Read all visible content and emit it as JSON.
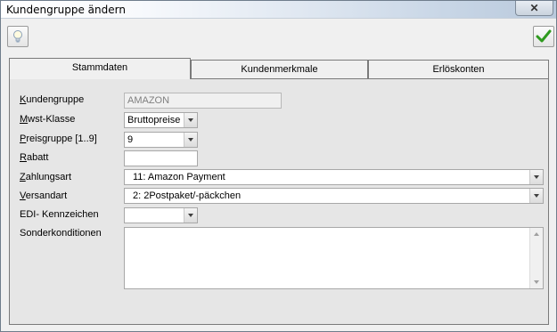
{
  "window": {
    "title": "Kundengruppe ändern",
    "close_label": "✕"
  },
  "toolbar": {
    "hint_icon": "lightbulb-icon",
    "ok_icon": "checkmark-icon"
  },
  "tabs": [
    {
      "label": "Stammdaten",
      "active": true
    },
    {
      "label": "Kundenmerkmale",
      "active": false
    },
    {
      "label": "Erlöskonten",
      "active": false
    }
  ],
  "form": {
    "kundengruppe": {
      "label_mn": "K",
      "label_rest": "undengruppe",
      "value": "AMAZON"
    },
    "mwst": {
      "label_mn": "M",
      "label_rest": "wst-Klasse",
      "value": "Bruttopreise"
    },
    "preisgruppe": {
      "label_mn": "P",
      "label_rest": "reisgruppe [1..9]",
      "value": "9"
    },
    "rabatt": {
      "label_mn": "R",
      "label_rest": "abatt",
      "value": ""
    },
    "zahlungsart": {
      "label_mn": "Z",
      "label_rest": "ahlungsart",
      "value": "11: Amazon Payment"
    },
    "versandart": {
      "label_mn": "V",
      "label_rest": "ersandart",
      "value": "2: 2Postpaket/-päckchen"
    },
    "edi": {
      "label": "EDI- Kennzeichen",
      "value": ""
    },
    "sonderkonditionen": {
      "label": "Sonderkonditionen",
      "value": ""
    }
  },
  "colors": {
    "ok_green": "#2e9a1e",
    "titlebar_end": "#b9c9dc"
  }
}
